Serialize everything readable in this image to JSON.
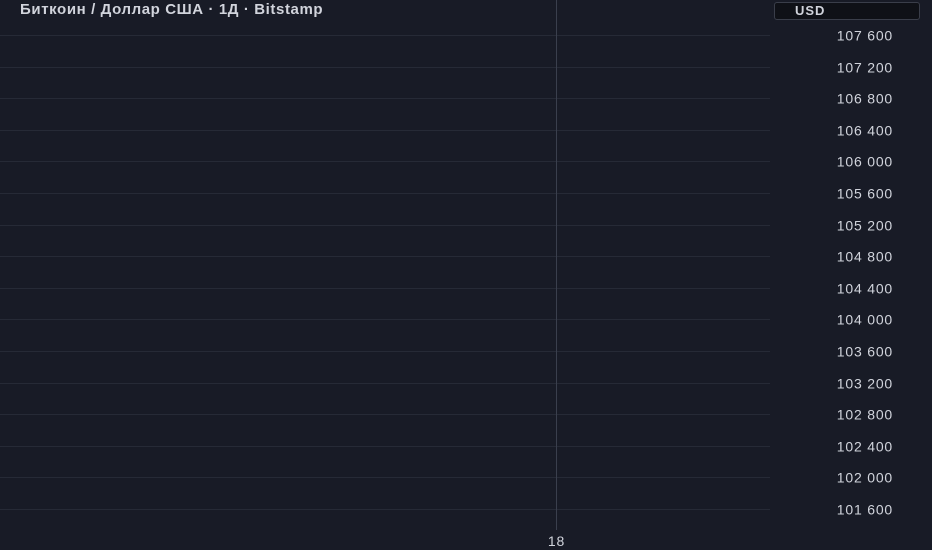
{
  "chart": {
    "title": "Биткоин / Доллар США · 1Д · Bitstamp",
    "currency": "USD"
  },
  "colors": {
    "background": "#181b26",
    "grid": "#262a36",
    "crosshair": "#3a3f4d",
    "text": "#d1d4dc",
    "badge_bg": "#0f1117"
  },
  "chart_data": {
    "type": "line",
    "series": [],
    "ylim": [
      101400,
      107800
    ],
    "y_ticks": [
      107600,
      107200,
      106800,
      106400,
      106000,
      105600,
      105200,
      104800,
      104400,
      104000,
      103600,
      103200,
      102800,
      102400,
      102000,
      101600
    ],
    "y_tick_labels": [
      "107 600",
      "107 200",
      "106 800",
      "106 400",
      "106 000",
      "105 600",
      "105 200",
      "104 800",
      "104 400",
      "104 000",
      "103 600",
      "103 200",
      "102 800",
      "102 400",
      "102 000",
      "101 600"
    ],
    "x_tick_labels": [
      "18"
    ],
    "grid": true,
    "crosshair": true
  }
}
